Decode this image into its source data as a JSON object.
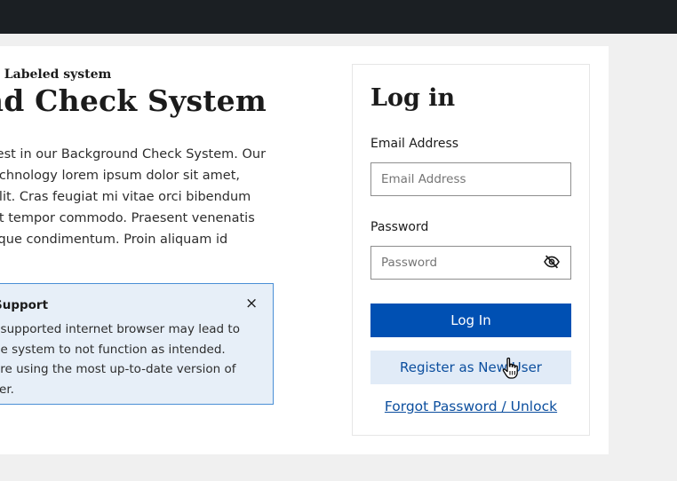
{
  "system": {
    "label": "e Labeled system",
    "title": "nd Check System",
    "intro_lines": [
      "rest in our Background Check System. Our",
      "echnology lorem ipsum dolor sit amet,",
      "elit. Cras feugiat mi vitae orci bibendum",
      "et tempor commodo. Praesent venenatis",
      "sque condimentum. Proin aliquam id"
    ]
  },
  "alert": {
    "heading": "Support",
    "close_icon": "×",
    "body_lines": [
      "nsupported internet browser may lead to",
      "he system to not function as intended.",
      "are using the most up-to-date version of",
      "ser."
    ]
  },
  "login": {
    "title": "Log in",
    "email_label": "Email Address",
    "email_placeholder": "Email Address",
    "password_label": "Password",
    "password_placeholder": "Password",
    "login_button": "Log In",
    "register_button": "Register as New User",
    "forgot_link": "Forgot Password / Unlock"
  },
  "colors": {
    "topbar": "#1b1f23",
    "primary": "#0050b3",
    "secondary_bg": "#e1ebf7",
    "alert_bg": "#e7eff8",
    "alert_border": "#4a8fd6"
  },
  "icons": {
    "password_toggle": "eye-slash-icon",
    "alert_close": "close-icon",
    "pointer": "hand-pointer-icon"
  }
}
